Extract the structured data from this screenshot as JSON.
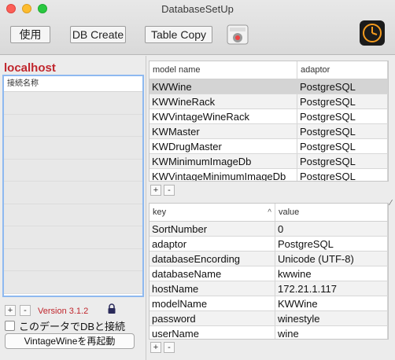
{
  "window": {
    "title": "DatabaseSetUp"
  },
  "toolbar": {
    "use_label": "使用",
    "dbcreate_label": "DB Create",
    "tablecopy_label": "Table Copy"
  },
  "left": {
    "host": "localhost",
    "conn_header": "接続名称",
    "add": "+",
    "remove": "-",
    "version": "Version 3.1.2",
    "checkbox_label": "このデータでDBと接続",
    "restart_label": "VintageWineを再起動"
  },
  "models": {
    "headers": [
      "model name",
      "adaptor"
    ],
    "rows": [
      [
        "KWWine",
        "PostgreSQL"
      ],
      [
        "KWWineRack",
        "PostgreSQL"
      ],
      [
        "KWVintageWineRack",
        "PostgreSQL"
      ],
      [
        "KWMaster",
        "PostgreSQL"
      ],
      [
        "KWDrugMaster",
        "PostgreSQL"
      ],
      [
        "KWMinimumImageDb",
        "PostgreSQL"
      ],
      [
        "KWVintageMinimumImageDb",
        "PostgreSQL"
      ]
    ],
    "add": "+",
    "remove": "-"
  },
  "props": {
    "headers": [
      "key",
      "value"
    ],
    "sort_indicator": "^",
    "rows": [
      [
        "SortNumber",
        "0"
      ],
      [
        "adaptor",
        "PostgreSQL"
      ],
      [
        "databaseEncording",
        "Unicode (UTF-8)"
      ],
      [
        "databaseName",
        "kwwine"
      ],
      [
        "hostName",
        "172.21.1.117"
      ],
      [
        "modelName",
        "KWWine"
      ],
      [
        "password",
        "winestyle"
      ],
      [
        "userName",
        "wine"
      ]
    ],
    "add": "+",
    "remove": "-"
  },
  "icons": {
    "app": "app-icon",
    "watch": "watch-icon",
    "lock": "lock-icon"
  },
  "colors": {
    "accent_red": "#c0262d",
    "focus_blue": "#8eb9f0",
    "watch_orange": "#f39a1d"
  }
}
